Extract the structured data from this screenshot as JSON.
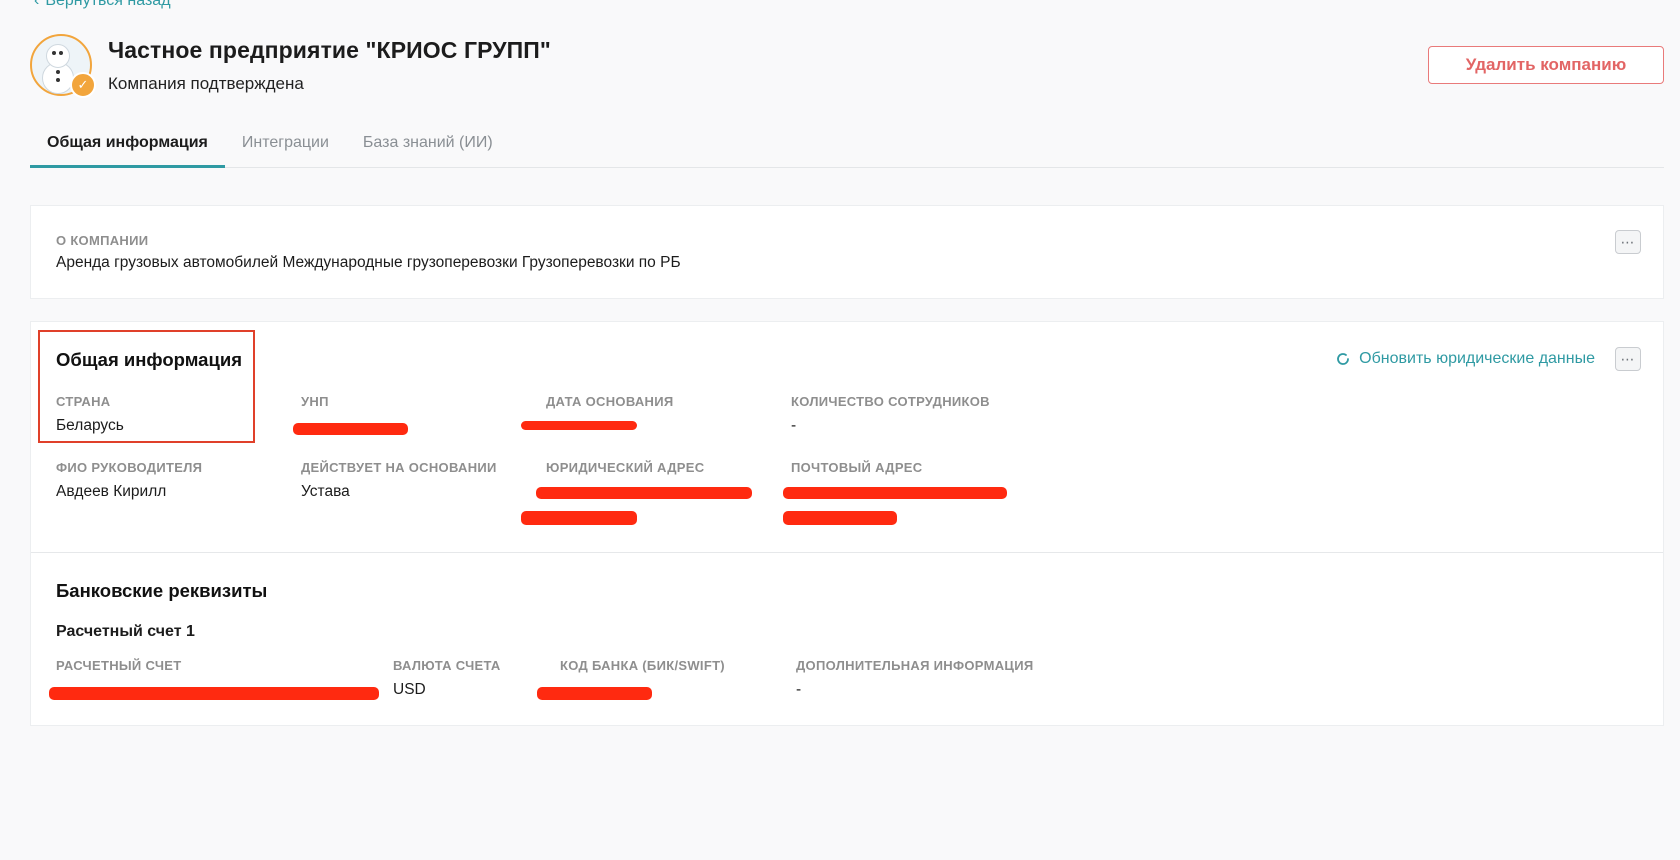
{
  "nav": {
    "back_label": "Вернуться назад"
  },
  "company": {
    "name": "Частное предприятие \"КРИОС ГРУПП\"",
    "status": "Компания подтверждена",
    "delete_label": "Удалить компанию"
  },
  "tabs": [
    {
      "label": "Общая информация",
      "active": true
    },
    {
      "label": "Интеграции",
      "active": false
    },
    {
      "label": "База знаний (ИИ)",
      "active": false
    }
  ],
  "about": {
    "label": "О КОМПАНИИ",
    "text": "Аренда грузовых автомобилей Международные грузоперевозки Грузоперевозки по РБ",
    "more_icon": "⋯"
  },
  "general": {
    "title": "Общая информация",
    "refresh_label": "Обновить юридические данные",
    "more_icon": "⋯",
    "fields": {
      "country": {
        "label": "СТРАНА",
        "value": "Беларусь"
      },
      "unp": {
        "label": "УНП",
        "value": ""
      },
      "founded": {
        "label": "ДАТА ОСНОВАНИЯ",
        "value": ""
      },
      "employees": {
        "label": "КОЛИЧЕСТВО СОТРУДНИКОВ",
        "value": "-"
      },
      "director": {
        "label": "ФИО РУКОВОДИТЕЛЯ",
        "value": "Авдеев Кирилл"
      },
      "basis": {
        "label": "ДЕЙСТВУЕТ НА ОСНОВАНИИ",
        "value": "Устава"
      },
      "legal_address": {
        "label": "ЮРИДИЧЕСКИЙ АДРЕС",
        "value": ""
      },
      "postal_address": {
        "label": "ПОЧТОВЫЙ АДРЕС",
        "value": ""
      }
    }
  },
  "bank": {
    "title": "Банковские реквизиты",
    "account_title": "Расчетный счет 1",
    "fields": {
      "account": {
        "label": "РАСЧЕТНЫЙ СЧЕТ",
        "value": ""
      },
      "currency": {
        "label": "ВАЛЮТА СЧЕТА",
        "value": "USD"
      },
      "bank_code": {
        "label": "КОД БАНКА (БИК/SWIFT)",
        "value": ""
      },
      "extra": {
        "label": "ДОПОЛНИТЕЛЬНАЯ ИНФОРМАЦИЯ",
        "value": "-"
      }
    }
  },
  "colors": {
    "accent": "#2f9aa3",
    "danger": "#e26565",
    "redaction": "#ff2a10",
    "highlight": "#e0402a"
  }
}
